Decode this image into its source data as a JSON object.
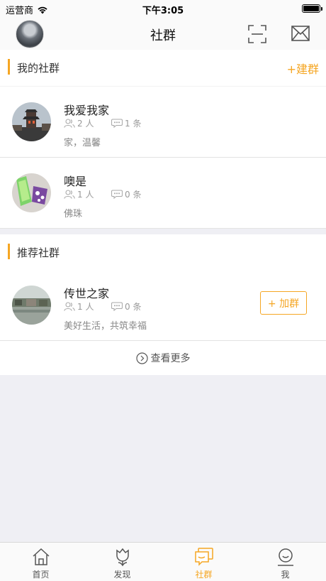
{
  "status_bar": {
    "carrier": "运营商",
    "time": "下午3:05"
  },
  "navbar": {
    "title": "社群"
  },
  "my_groups": {
    "header": "我的社群",
    "create_label": "+建群",
    "items": [
      {
        "name": "我爱我家",
        "members": "2 人",
        "posts": "1 条",
        "desc": "家，温馨"
      },
      {
        "name": "噢是",
        "members": "1 人",
        "posts": "0 条",
        "desc": "佛珠"
      }
    ]
  },
  "recommended_groups": {
    "header": "推荐社群",
    "items": [
      {
        "name": "传世之家",
        "members": "1 人",
        "posts": "0 条",
        "desc": "美好生活，共筑幸福",
        "join_label": "+ 加群"
      }
    ],
    "more_label": "查看更多"
  },
  "tabbar": {
    "tabs": [
      {
        "label": "首页",
        "icon": "home-icon"
      },
      {
        "label": "发现",
        "icon": "tulip-icon"
      },
      {
        "label": "社群",
        "icon": "chat-icon"
      },
      {
        "label": "我",
        "icon": "profile-icon"
      }
    ],
    "active_index": 2
  },
  "colors": {
    "accent": "#f5a623",
    "background": "#efeff4"
  }
}
